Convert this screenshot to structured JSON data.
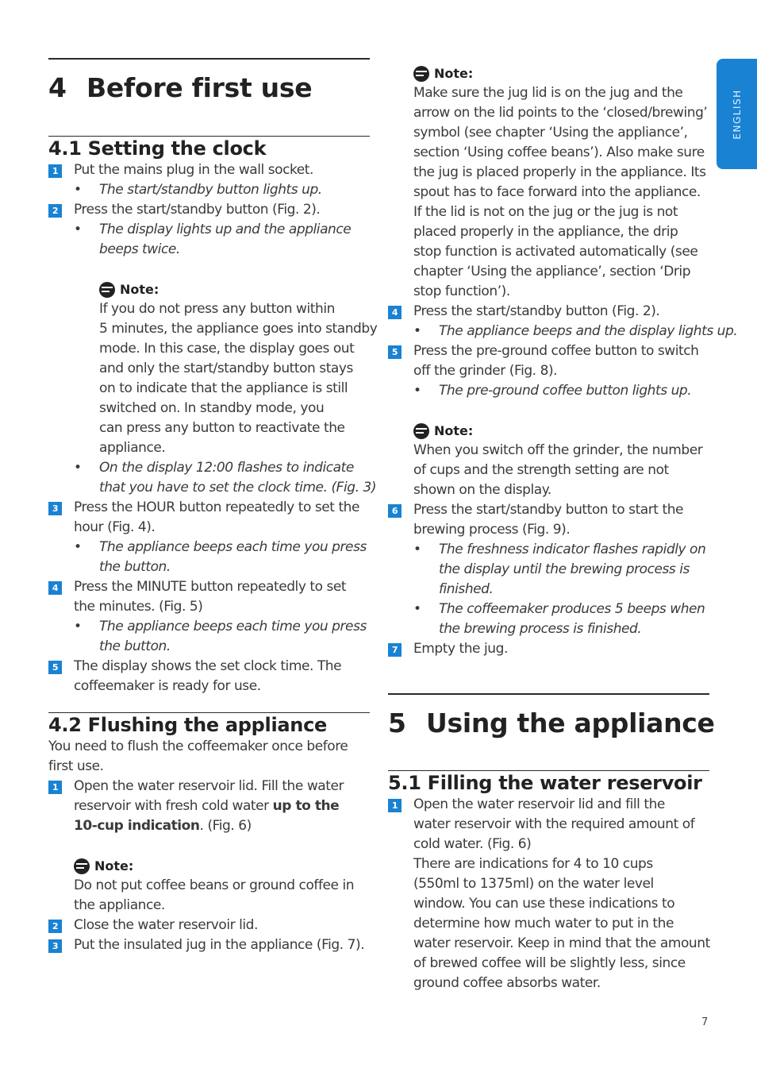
{
  "side_tab": {
    "label": "ENGLISH"
  },
  "page_number": "7",
  "note_label": "Note:",
  "chapter4": {
    "number": "4",
    "title": "Before first use",
    "s41": {
      "title": "4.1  Setting the clock",
      "step1": "Put the mains plug in the wall socket.",
      "step1_b1": "The start/standby button lights up.",
      "step2": "Press the start/standby button (Fig. 2).",
      "step2_b1_l1": "The display lights up and the appliance",
      "step2_b1_l2": "beeps twice.",
      "note_lines": [
        "If you do not press any button within",
        "5 minutes, the appliance goes into standby",
        "mode. In this case, the display goes out",
        "and only the start/standby button stays",
        "on to indicate that the appliance is still",
        "switched on. In standby mode, you",
        "can press any button to reactivate the",
        "appliance."
      ],
      "step2_b2_l1": "On the display 12:00 flashes to indicate",
      "step2_b2_l2": "that you have to set the clock time.  (Fig. 3)",
      "step3_l1": "Press the HOUR button repeatedly to set the",
      "step3_l2": "hour (Fig. 4).",
      "step3_b1_l1": "The appliance beeps each time you press",
      "step3_b1_l2": "the button.",
      "step4_l1": "Press the MINUTE button repeatedly to set",
      "step4_l2": "the minutes.  (Fig. 5)",
      "step4_b1_l1": "The appliance beeps each time you press",
      "step4_b1_l2": "the button.",
      "step5_l1": "The display shows the set clock time. The",
      "step5_l2": "coffeemaker is ready for use."
    },
    "s42": {
      "title": "4.2  Flushing the appliance",
      "intro_l1": "You need to flush the coffeemaker once before",
      "intro_l2": "first use.",
      "step1_l1": "Open the water reservoir lid. Fill the water",
      "step1_l2a": "reservoir with fresh cold water ",
      "step1_l2b": "up to the",
      "step1_l3a": "10-cup indication",
      "step1_l3b": ".  (Fig. 6)",
      "note_l1": "Do not put coffee beans or ground coffee in",
      "note_l2": "the appliance.",
      "step2": "Close the water reservoir lid.",
      "step3": "Put the insulated jug in the appliance (Fig. 7)."
    }
  },
  "right": {
    "note1_lines": [
      "Make sure the jug lid is on the jug and the",
      "arrow on the lid points to the ‘closed/brewing’",
      "symbol (see chapter ‘Using the appliance’,",
      "section ‘Using coffee beans’). Also make sure",
      "the jug is placed properly in the appliance. Its",
      "spout has to face forward into the appliance.",
      "If the lid is not on the jug or the jug is not",
      "placed properly in the appliance, the drip",
      "stop function is activated automatically (see",
      "chapter ‘Using the appliance’, section ‘Drip",
      "stop function’)."
    ],
    "step4": "Press the start/standby button (Fig. 2).",
    "step4_b1": "The appliance beeps and the display lights up.",
    "step5_l1": "Press the pre-ground coffee button to switch",
    "step5_l2": "off the grinder (Fig. 8).",
    "step5_b1": "The pre-ground coffee button lights up.",
    "note2_lines": [
      "When you switch off the grinder, the number",
      "of cups and the strength setting are not",
      "shown on the display."
    ],
    "step6_l1": "Press the start/standby button to start the",
    "step6_l2": "brewing process (Fig. 9).",
    "step6_b1_l1": "The freshness indicator flashes rapidly on",
    "step6_b1_l2": "the display until the brewing process is",
    "step6_b1_l3": "finished.",
    "step6_b2_l1": "The coffeemaker produces 5 beeps when",
    "step6_b2_l2": "the brewing process is finished.",
    "step7": "Empty the jug."
  },
  "chapter5": {
    "number": "5",
    "title": "Using the appliance",
    "s51": {
      "title": "5.1  Filling the water reservoir",
      "step1_lines": [
        "Open the water reservoir lid and fill the",
        "water reservoir with the required amount of",
        "cold water.  (Fig. 6)",
        "There are indications for 4 to 10 cups",
        "(550ml to 1375ml) on the water level",
        "window. You can use these indications to",
        "determine how much water to put in the",
        "water reservoir. Keep in mind that the amount",
        "of brewed coffee will be slightly less, since",
        "ground coffee absorbs water."
      ]
    }
  },
  "badges": [
    "1",
    "2",
    "3",
    "4",
    "5",
    "6",
    "7"
  ]
}
